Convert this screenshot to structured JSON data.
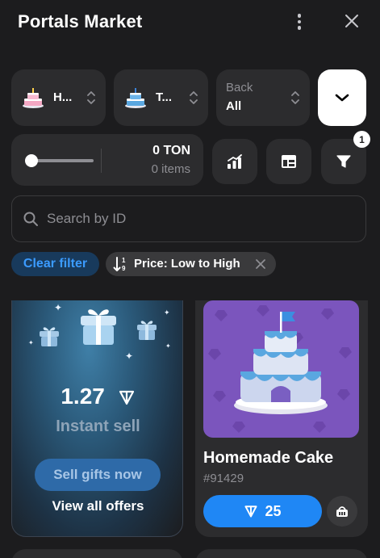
{
  "header": {
    "title": "Portals Market"
  },
  "filters": {
    "collection_value": "H...",
    "model_value": "T...",
    "backdrop_label": "Back",
    "backdrop_value": "All"
  },
  "price_range": {
    "ton": "0 TON",
    "items": "0 items"
  },
  "filter_badge": "1",
  "search": {
    "placeholder": "Search by ID"
  },
  "chips": {
    "clear_label": "Clear filter",
    "sort_label": "Price: Low to High"
  },
  "sell_card": {
    "price": "1.27",
    "subtitle": "Instant sell",
    "button_label": "Sell gifts now",
    "link_label": "View all offers"
  },
  "gift_card": {
    "name": "Homemade Cake",
    "number": "#91429",
    "price": "25"
  },
  "colors": {
    "background": "#1c1c1e",
    "surface": "#2c2c2e",
    "accent": "#1f87f5",
    "cake_backdrop": "#7b55bd"
  },
  "icons": [
    "kebab-menu-icon",
    "close-icon",
    "chevron-down-icon",
    "chart-icon",
    "table-icon",
    "funnel-icon",
    "search-icon",
    "sort-icon",
    "ton-icon",
    "gift-icon",
    "cart-icon"
  ]
}
